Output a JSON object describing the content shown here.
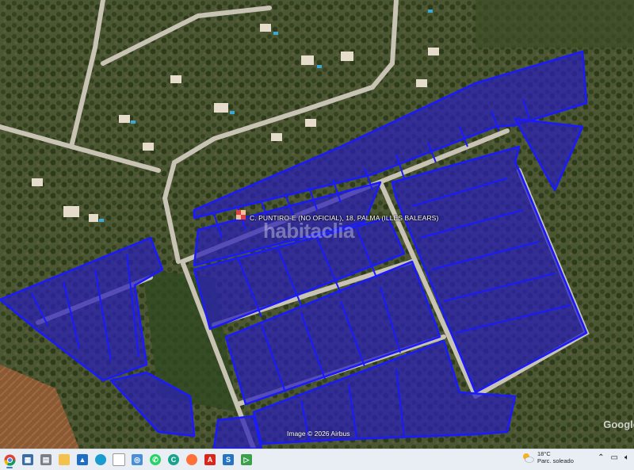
{
  "map": {
    "place_label": "C. PUNTIRO-E (NO OFICIAL), 18, PALMA (ILLES BALEARS)",
    "watermark": "habitaclia",
    "imagery_credit": "Image © 2026 Airbus",
    "provider": "Google",
    "parcel_fill_color": "#2a1fb8",
    "parcel_stroke_color": "#1a1aff"
  },
  "taskbar": {
    "apps": [
      "chrome-icon",
      "app-icon",
      "files-icon",
      "explorer-icon",
      "image-viewer-icon",
      "edge-icon",
      "document-icon",
      "maps-icon",
      "whatsapp-icon",
      "teams-icon",
      "firefox-icon",
      "acrobat-icon",
      "app-s-icon",
      "app-green-icon"
    ],
    "weather": {
      "temp": "18°C",
      "condition": "Parc. soleado"
    }
  }
}
